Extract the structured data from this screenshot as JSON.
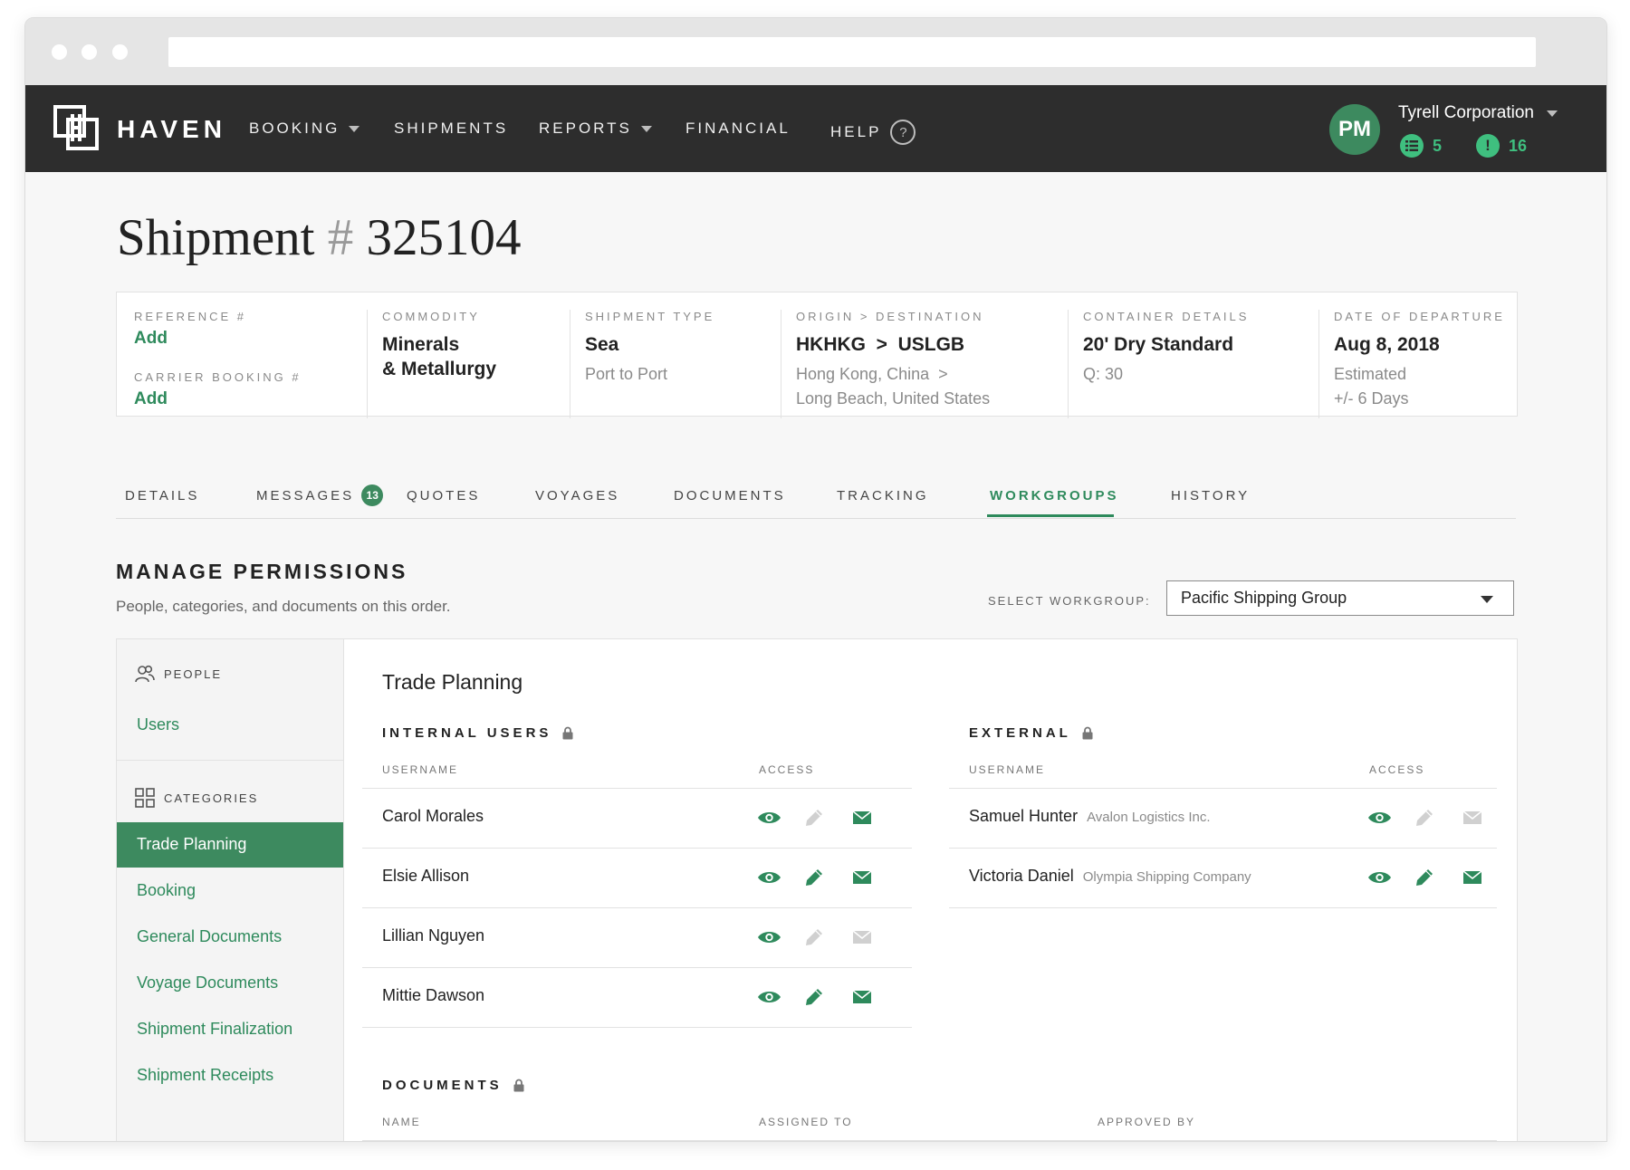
{
  "nav": {
    "brand": "HAVEN",
    "items": [
      {
        "label": "BOOKING",
        "dropdown": true
      },
      {
        "label": "SHIPMENTS",
        "dropdown": false
      },
      {
        "label": "REPORTS",
        "dropdown": true
      },
      {
        "label": "FINANCIAL",
        "dropdown": false
      },
      {
        "label": "HELP",
        "dropdown": false
      }
    ],
    "help_icon": "?",
    "user_initials": "PM",
    "organization": "Tyrell Corporation",
    "list_count": "5",
    "alert_count": "16",
    "alert_icon": "!"
  },
  "page": {
    "title_prefix": "Shipment",
    "title_hash": "#",
    "shipment_number": "325104"
  },
  "summary": {
    "reference_label": "REFERENCE #",
    "reference_value": "Add",
    "carrier_label": "CARRIER BOOKING #",
    "carrier_value": "Add",
    "commodity_label": "COMMODITY",
    "commodity_line1": "Minerals",
    "commodity_line2": "& Metallurgy",
    "type_label": "SHIPMENT TYPE",
    "type_value": "Sea",
    "type_sub": "Port to Port",
    "route_label": "ORIGIN > DESTINATION",
    "route_value": "HKHKG  >  USLGB",
    "route_sub1": "Hong Kong, China  >",
    "route_sub2": "Long Beach, United States",
    "container_label": "CONTAINER DETAILS",
    "container_value": "20' Dry Standard",
    "container_sub": "Q: 30",
    "departure_label": "DATE OF DEPARTURE",
    "departure_value": "Aug 8, 2018",
    "departure_sub1": "Estimated",
    "departure_sub2": "+/- 6 Days"
  },
  "tabs": [
    {
      "label": "DETAILS"
    },
    {
      "label": "MESSAGES",
      "badge": "13"
    },
    {
      "label": "QUOTES"
    },
    {
      "label": "VOYAGES"
    },
    {
      "label": "DOCUMENTS"
    },
    {
      "label": "TRACKING"
    },
    {
      "label": "WORKGROUPS",
      "active": true
    },
    {
      "label": "HISTORY"
    }
  ],
  "permissions": {
    "title": "MANAGE PERMISSIONS",
    "subtitle": "People, categories, and documents on this order.",
    "select_label": "SELECT WORKGROUP:",
    "selected_workgroup": "Pacific Shipping Group"
  },
  "sidebar": {
    "people_heading": "PEOPLE",
    "people_items": [
      "Users"
    ],
    "categories_heading": "CATEGORIES",
    "categories": [
      {
        "label": "Trade Planning",
        "active": true
      },
      {
        "label": "Booking"
      },
      {
        "label": "General Documents"
      },
      {
        "label": "Voyage Documents"
      },
      {
        "label": "Shipment Finalization"
      },
      {
        "label": "Shipment Receipts"
      }
    ]
  },
  "content": {
    "title": "Trade Planning",
    "internal_heading": "INTERNAL USERS",
    "external_heading": "EXTERNAL",
    "col_username": "USERNAME",
    "col_access": "ACCESS",
    "internal_users": [
      {
        "name": "Carol Morales",
        "view": true,
        "edit": false,
        "email": true
      },
      {
        "name": "Elsie Allison",
        "view": true,
        "edit": true,
        "email": true
      },
      {
        "name": "Lillian Nguyen",
        "view": true,
        "edit": false,
        "email": false
      },
      {
        "name": "Mittie Dawson",
        "view": true,
        "edit": true,
        "email": true
      }
    ],
    "external_users": [
      {
        "name": "Samuel Hunter",
        "company": "Avalon Logistics Inc.",
        "view": true,
        "edit": false,
        "email": false
      },
      {
        "name": "Victoria Daniel",
        "company": "Olympia Shipping Company",
        "view": true,
        "edit": true,
        "email": true
      }
    ],
    "documents_heading": "DOCUMENTS",
    "doc_col_name": "NAME",
    "doc_col_assigned": "ASSIGNED TO",
    "doc_col_approved": "APPROVED BY"
  },
  "colors": {
    "accent": "#2e8a5c",
    "accent_fill": "#3d8a5f",
    "nav_bg": "#2d2d2d",
    "badge_green": "#3fbf7f",
    "icon_disabled": "#d0d0d0"
  },
  "icons": {
    "view": "eye-icon",
    "edit": "pencil-icon",
    "email": "envelope-icon",
    "lock": "lock-icon",
    "people": "people-icon",
    "categories": "grid-icon",
    "list": "list-icon",
    "alert": "alert-icon"
  }
}
